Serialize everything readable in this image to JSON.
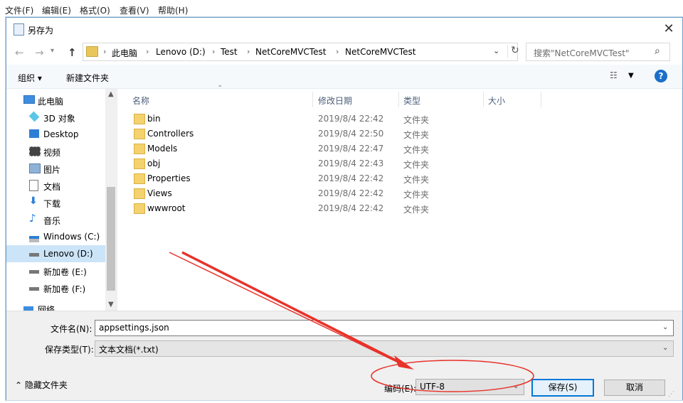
{
  "app_menu": [
    "文件(F)",
    "编辑(E)",
    "格式(O)",
    "查看(V)",
    "帮助(H)"
  ],
  "dialog": {
    "title": "另存为",
    "close_glyph": "✕"
  },
  "address": {
    "breadcrumbs": [
      "此电脑",
      "Lenovo (D:)",
      "Test",
      "NetCoreMVCTest",
      "NetCoreMVCTest"
    ],
    "search_placeholder": "搜索\"NetCoreMVCTest\""
  },
  "toolbar": {
    "organize_label": "组织 ▾",
    "new_folder_label": "新建文件夹",
    "help_label": "?"
  },
  "nav": [
    {
      "label": "此电脑",
      "icon": "pc-icon",
      "top": true
    },
    {
      "label": "3D 对象",
      "icon": "cube-icon"
    },
    {
      "label": "Desktop",
      "icon": "desktop-icon"
    },
    {
      "label": "视频",
      "icon": "video-icon"
    },
    {
      "label": "图片",
      "icon": "picture-icon"
    },
    {
      "label": "文档",
      "icon": "document-icon"
    },
    {
      "label": "下载",
      "icon": "download-icon"
    },
    {
      "label": "音乐",
      "icon": "music-icon"
    },
    {
      "label": "Windows (C:)",
      "icon": "windows-drive-icon"
    },
    {
      "label": "Lenovo (D:)",
      "icon": "drive-icon",
      "selected": true
    },
    {
      "label": "新加卷 (E:)",
      "icon": "drive-icon"
    },
    {
      "label": "新加卷 (F:)",
      "icon": "drive-icon"
    },
    {
      "label": "网络",
      "icon": "network-icon",
      "top": true
    }
  ],
  "columns": [
    "名称",
    "修改日期",
    "类型",
    "大小"
  ],
  "files": [
    {
      "name": "bin",
      "date": "2019/8/4 22:42",
      "type": "文件夹"
    },
    {
      "name": "Controllers",
      "date": "2019/8/4 22:50",
      "type": "文件夹"
    },
    {
      "name": "Models",
      "date": "2019/8/4 22:47",
      "type": "文件夹"
    },
    {
      "name": "obj",
      "date": "2019/8/4 22:43",
      "type": "文件夹"
    },
    {
      "name": "Properties",
      "date": "2019/8/4 22:42",
      "type": "文件夹"
    },
    {
      "name": "Views",
      "date": "2019/8/4 22:42",
      "type": "文件夹"
    },
    {
      "name": "wwwroot",
      "date": "2019/8/4 22:42",
      "type": "文件夹"
    }
  ],
  "bottom": {
    "filename_label": "文件名(N):",
    "filename_value": "appsettings.json",
    "filetype_label": "保存类型(T):",
    "filetype_value": "文本文档(*.txt)",
    "hide_folders_label": "隐藏文件夹",
    "encoding_label": "编码(E):",
    "encoding_value": "UTF-8",
    "save_label": "保存(S)",
    "cancel_label": "取消"
  },
  "colors": {
    "annotation": "#e8322a",
    "selection": "#cce4f7",
    "accent": "#0078d7"
  }
}
